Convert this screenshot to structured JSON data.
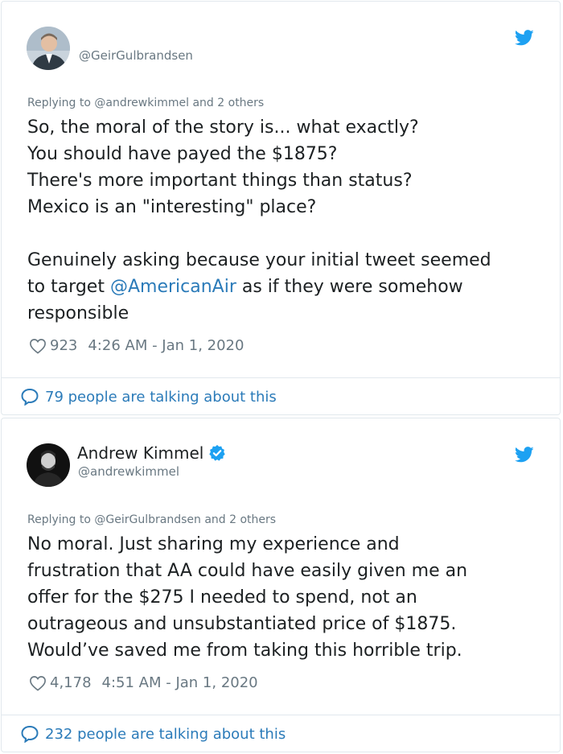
{
  "tweets": [
    {
      "handle": "@GeirGulbrandsen",
      "reply_prefix": "Replying to ",
      "reply_handle": "@andrewkimmel",
      "reply_suffix": " and 2 others",
      "text_lines": [
        "So, the moral of the story is... what exactly?",
        "You should have payed the $1875?",
        "There's more important things than status?",
        "Mexico is an \"interesting\" place?"
      ],
      "text_para2_line1": "Genuinely asking because your initial tweet seemed",
      "text_para2_line2_before": "to target ",
      "text_para2_line2_mention": "@AmericanAir",
      "text_para2_line2_after": " as if they were somehow",
      "text_para2_line3": "responsible",
      "likes": "923",
      "timestamp": "4:26 AM - Jan 1, 2020",
      "talking": "79 people are talking about this"
    },
    {
      "name": "Andrew Kimmel",
      "handle": "@andrewkimmel",
      "reply_prefix": "Replying to ",
      "reply_handle": "@GeirGulbrandsen",
      "reply_suffix": " and 2 others",
      "text_lines": [
        "No moral. Just sharing my experience and",
        "frustration that AA could have easily given me an",
        "offer for the $275 I needed to spend, not an",
        "outrageous and unsubstantiated price of $1875.",
        "Would’ve saved me from taking this horrible trip."
      ],
      "likes": "4,178",
      "timestamp": "4:51 AM - Jan 1, 2020",
      "talking": "232 people are talking about this"
    }
  ],
  "icons": {
    "bird": "twitter-bird-icon",
    "heart": "heart-icon",
    "bubble": "speech-bubble-icon",
    "verified": "verified-badge-icon"
  },
  "colors": {
    "link": "#2b7bb9",
    "twitter_blue": "#1da1f2",
    "muted": "#697882",
    "text": "#1c2022",
    "border": "#e1e8ed"
  }
}
